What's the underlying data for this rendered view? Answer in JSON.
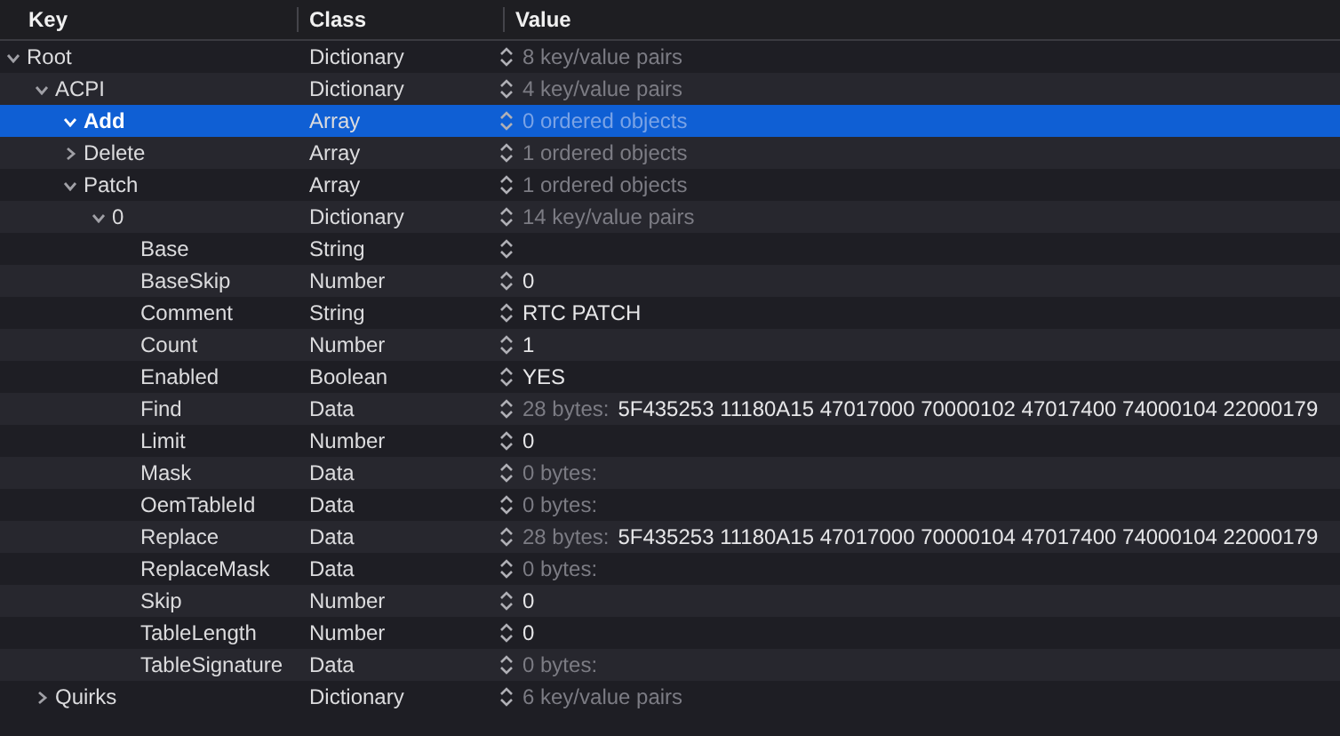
{
  "columns": [
    "Key",
    "Class",
    "Value"
  ],
  "tree": [
    {
      "key": "Root",
      "class": "Dictionary",
      "value_note": "8 key/value pairs",
      "expanded": true,
      "selected": false,
      "children": [
        {
          "key": "ACPI",
          "class": "Dictionary",
          "value_note": "4 key/value pairs",
          "expanded": true,
          "selected": false,
          "children": [
            {
              "key": "Add",
              "class": "Array",
              "value_note": "0 ordered objects",
              "expanded": true,
              "selected": true
            },
            {
              "key": "Delete",
              "class": "Array",
              "value_note": "1 ordered objects",
              "expanded": false,
              "selected": false
            },
            {
              "key": "Patch",
              "class": "Array",
              "value_note": "1 ordered objects",
              "expanded": true,
              "selected": false,
              "children": [
                {
                  "key": "0",
                  "class": "Dictionary",
                  "value_note": "14 key/value pairs",
                  "expanded": true,
                  "selected": false,
                  "children": [
                    {
                      "key": "Base",
                      "class": "String",
                      "selected": false
                    },
                    {
                      "key": "BaseSkip",
                      "class": "Number",
                      "value": "0",
                      "selected": false
                    },
                    {
                      "key": "Comment",
                      "class": "String",
                      "value": "RTC PATCH",
                      "selected": false
                    },
                    {
                      "key": "Count",
                      "class": "Number",
                      "value": "1",
                      "selected": false
                    },
                    {
                      "key": "Enabled",
                      "class": "Boolean",
                      "value": "YES",
                      "selected": false
                    },
                    {
                      "key": "Find",
                      "class": "Data",
                      "value_note": "28 bytes:",
                      "value": "5F435253 11180A15 47017000 70000102 47017400 74000104 22000179",
                      "selected": false
                    },
                    {
                      "key": "Limit",
                      "class": "Number",
                      "value": "0",
                      "selected": false
                    },
                    {
                      "key": "Mask",
                      "class": "Data",
                      "value_note": "0 bytes:",
                      "selected": false
                    },
                    {
                      "key": "OemTableId",
                      "class": "Data",
                      "value_note": "0 bytes:",
                      "selected": false
                    },
                    {
                      "key": "Replace",
                      "class": "Data",
                      "value_note": "28 bytes:",
                      "value": "5F435253 11180A15 47017000 70000104 47017400 74000104 22000179",
                      "selected": false
                    },
                    {
                      "key": "ReplaceMask",
                      "class": "Data",
                      "value_note": "0 bytes:",
                      "selected": false
                    },
                    {
                      "key": "Skip",
                      "class": "Number",
                      "value": "0",
                      "selected": false
                    },
                    {
                      "key": "TableLength",
                      "class": "Number",
                      "value": "0",
                      "selected": false
                    },
                    {
                      "key": "TableSignature",
                      "class": "Data",
                      "value_note": "0 bytes:",
                      "selected": false
                    }
                  ]
                }
              ]
            }
          ]
        },
        {
          "key": "Quirks",
          "class": "Dictionary",
          "value_note": "6 key/value pairs",
          "expanded": false,
          "selected": false
        }
      ]
    }
  ]
}
